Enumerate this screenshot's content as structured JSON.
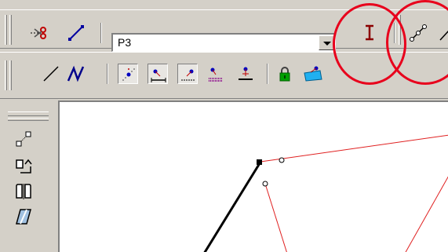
{
  "toolbar1": {
    "buttons": [
      {
        "name": "cut-icon",
        "pressed": false
      },
      {
        "name": "draw-line-icon",
        "pressed": false
      }
    ],
    "combo_value": "P3",
    "right_buttons": [
      {
        "name": "text-cursor-icon"
      },
      {
        "name": "polyline-point-icon"
      }
    ]
  },
  "toolbar2": {
    "buttons": [
      {
        "name": "line-tool-icon",
        "pressed": false
      },
      {
        "name": "polyline-tool-icon",
        "pressed": false
      },
      {
        "name": "snap-point-icon",
        "pressed": true
      },
      {
        "name": "snap-segment-icon",
        "pressed": true
      },
      {
        "name": "snap-midpoint-icon",
        "pressed": true
      },
      {
        "name": "snap-dotted-icon",
        "pressed": false
      },
      {
        "name": "snap-base-icon",
        "pressed": false
      },
      {
        "name": "lock-icon",
        "pressed": false
      },
      {
        "name": "layer-icon",
        "pressed": false
      }
    ]
  },
  "left_panel": {
    "buttons": [
      "scale-icon",
      "rotate-icon",
      "mirror-icon",
      "shear-icon"
    ]
  },
  "colors": {
    "highlight": "#e8001c",
    "drawing_red": "#e02020",
    "drawing_black": "#000000",
    "face": "#d4d0c8"
  }
}
